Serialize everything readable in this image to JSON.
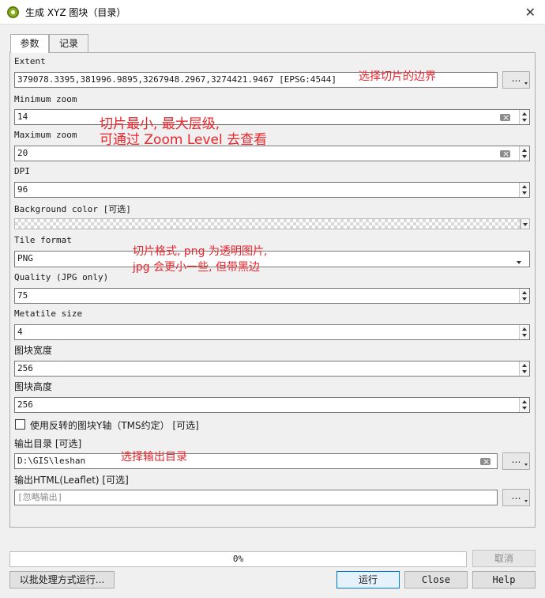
{
  "window": {
    "title": "生成 XYZ 图块（目录）",
    "close_glyph": "✕"
  },
  "tabs": [
    {
      "label": "参数",
      "active": true
    },
    {
      "label": "记录",
      "active": false
    }
  ],
  "params": {
    "extent": {
      "label": "Extent",
      "value": "379078.3395,381996.9895,3267948.2967,3274421.9467 [EPSG:4544]",
      "note": "选择切片的边界"
    },
    "min_zoom": {
      "label": "Minimum zoom",
      "value": "14"
    },
    "max_zoom": {
      "label": "Maximum zoom",
      "value": "20"
    },
    "zoom_note": "切片最小, 最大层级,\n可通过 Zoom Level 去查看",
    "dpi": {
      "label": "DPI",
      "value": "96"
    },
    "background_color": {
      "label": "Background color [可选]"
    },
    "tile_format": {
      "label": "Tile format",
      "value": "PNG",
      "note": "切片格式, png 为透明图片,\njpg 会更小一些, 但带黑边"
    },
    "quality": {
      "label": "Quality (JPG only)",
      "value": "75"
    },
    "metatile_size": {
      "label": "Metatile size",
      "value": "4"
    },
    "tile_width": {
      "label": "图块宽度",
      "value": "256"
    },
    "tile_height": {
      "label": "图块高度",
      "value": "256"
    },
    "tms_checkbox": {
      "label": "使用反转的图块Y轴（TMS约定） [可选]",
      "checked": false
    },
    "output_dir": {
      "label": "输出目录 [可选]",
      "value": "D:\\GIS\\leshan",
      "note": "选择输出目录"
    },
    "output_html": {
      "label": "输出HTML(Leaflet) [可选]",
      "placeholder": "[忽略输出]"
    }
  },
  "dots_label": "…",
  "progress": {
    "text": "0%",
    "fraction": 0
  },
  "buttons": {
    "cancel": "取消",
    "batch": "以批处理方式运行...",
    "run": "运行",
    "close": "Close",
    "help": "Help"
  },
  "colors": {
    "annotation": "#e8262d",
    "app_icon": "#93b023",
    "primary_border": "#0078d7"
  }
}
